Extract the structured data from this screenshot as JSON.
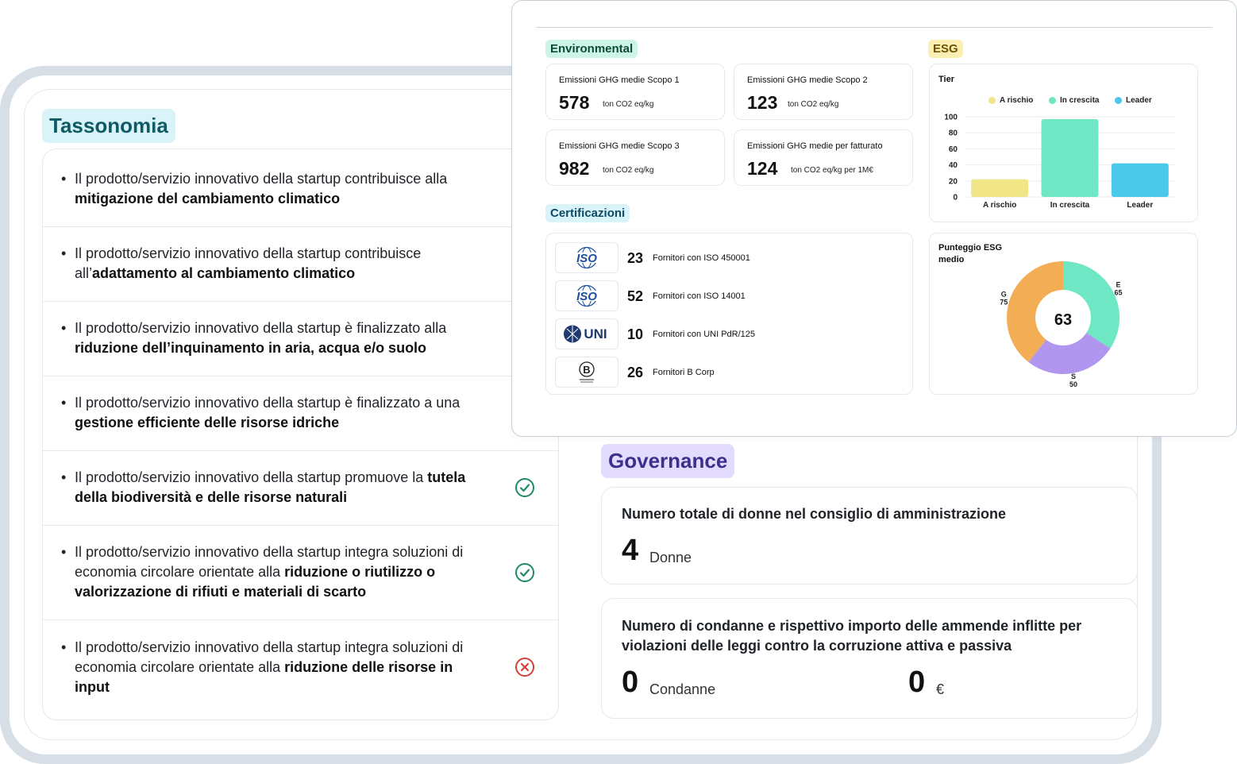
{
  "colors": {
    "tassonomia_tag_bg": "#d9f4f8",
    "tassonomia_tag_text": "#0e5a66",
    "governance_tag_bg": "#e4dcff",
    "governance_tag_text": "#3d2f8a",
    "environmental_tag_bg": "#cdf5e6",
    "environmental_tag_text": "#0e4a3a",
    "esg_tag_bg": "#fbefb3",
    "esg_tag_text": "#6b5200",
    "cert_tag_bg": "#d9f4f8",
    "check_green": "#1f8a6a",
    "cross_red": "#d2403a",
    "a_rischio": "#f0e687",
    "in_crescita": "#6fe6c4",
    "leader": "#4cc8ea",
    "donut_e": "#6fe6c4",
    "donut_s": "#b096ee",
    "donut_g": "#f3ad54"
  },
  "icons": {
    "check": "check-circle-icon",
    "cross": "x-circle-icon"
  },
  "tassonomia": {
    "title": "Tassonomia",
    "rows": [
      {
        "pre": "Il prodotto/servizio innovativo della startup contribuisce alla ",
        "bold": "mitigazione del cambiamento climatico",
        "post": "",
        "status": ""
      },
      {
        "pre": "Il prodotto/servizio innovativo della startup contribuisce all’",
        "bold": "adattamento al cambiamento climatico",
        "post": "",
        "status": ""
      },
      {
        "pre": "Il prodotto/servizio innovativo della startup è finalizzato alla ",
        "bold": "riduzione dell’inquinamento in aria, acqua e/o suolo",
        "post": "",
        "status": ""
      },
      {
        "pre": "Il prodotto/servizio innovativo della startup è finalizzato a una ",
        "bold": "gestione efficiente delle risorse idriche",
        "post": "",
        "status": ""
      },
      {
        "pre": "Il prodotto/servizio innovativo della startup promuove la ",
        "bold": "tutela della biodiversità e delle risorse naturali",
        "post": "",
        "status": "check"
      },
      {
        "pre": "Il prodotto/servizio innovativo della startup integra soluzioni di economia circolare orientate alla ",
        "bold": "riduzione o riutilizzo o valorizzazione di rifiuti e materiali di scarto",
        "post": "",
        "status": "check"
      },
      {
        "pre": "Il prodotto/servizio innovativo della startup integra soluzioni di economia circolare orientate alla ",
        "bold": "riduzione delle risorse in input",
        "post": "",
        "status": "cross"
      }
    ]
  },
  "governance": {
    "title": "Governance",
    "women": {
      "title": "Numero totale di donne nel consiglio di amministrazione",
      "value": "4",
      "unit": "Donne"
    },
    "convictions": {
      "title": "Numero di condanne e rispettivo importo delle ammende inflitte per violazioni delle leggi contro la corruzione attiva e passiva",
      "count": "0",
      "count_unit": "Condanne",
      "amount": "0",
      "amount_unit": "€"
    }
  },
  "environmental": {
    "title": "Environmental",
    "cards": [
      {
        "title": "Emissioni GHG medie Scopo 1",
        "value": "578",
        "unit": "ton CO2 eq/kg"
      },
      {
        "title": "Emissioni GHG medie Scopo 2",
        "value": "123",
        "unit": "ton CO2 eq/kg"
      },
      {
        "title": "Emissioni GHG medie Scopo 3",
        "value": "982",
        "unit": "ton CO2 eq/kg"
      },
      {
        "title": "Emissioni GHG medie per fatturato",
        "value": "124",
        "unit": "ton CO2 eq/kg per 1M€"
      }
    ]
  },
  "certificazioni": {
    "title": "Certificazioni",
    "items": [
      {
        "logo": "ISO",
        "count": "23",
        "label": "Fornitori con ISO 450001"
      },
      {
        "logo": "ISO",
        "count": "52",
        "label": "Fornitori con ISO 14001"
      },
      {
        "logo": "UNI",
        "count": "10",
        "label": "Fornitori con UNI PdR/125"
      },
      {
        "logo": "B",
        "count": "26",
        "label": "Fornitori B Corp"
      }
    ]
  },
  "esg": {
    "title": "ESG",
    "score_title": "Punteggio ESG medio",
    "score_value": "63"
  },
  "chart_data": [
    {
      "type": "bar",
      "title": "Tier",
      "categories": [
        "A rischio",
        "In crescita",
        "Leader"
      ],
      "values": [
        22,
        97,
        42
      ],
      "yticks": [
        "100",
        "80",
        "60",
        "40",
        "20",
        "0"
      ],
      "ylim": [
        0,
        100
      ],
      "legend": [
        "A rischio",
        "In crescita",
        "Leader"
      ],
      "legend_position": "top",
      "grid": true
    },
    {
      "type": "pie",
      "title": "Punteggio ESG medio",
      "center_label": "63",
      "slices": [
        {
          "name": "E",
          "value": 65
        },
        {
          "name": "S",
          "value": 50
        },
        {
          "name": "G",
          "value": 75
        }
      ]
    }
  ]
}
